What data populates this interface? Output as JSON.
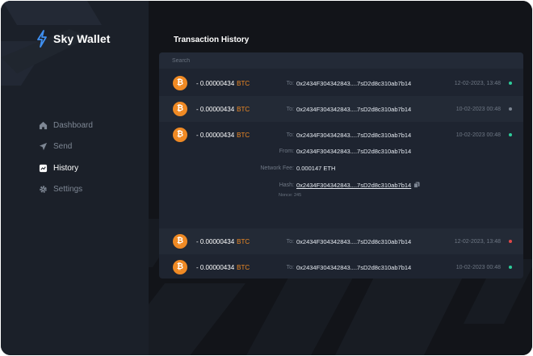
{
  "app": {
    "name": "Sky Wallet"
  },
  "colors": {
    "accent": "#f08a24",
    "success": "#2ecc9a",
    "error": "#e04848",
    "muted": "#7b8491"
  },
  "sidebar": {
    "items": [
      {
        "label": "Dashboard",
        "icon": "home-icon",
        "active": false
      },
      {
        "label": "Send",
        "icon": "send-icon",
        "active": false
      },
      {
        "label": "History",
        "icon": "history-icon",
        "active": true
      },
      {
        "label": "Settings",
        "icon": "gear-icon",
        "active": false
      }
    ]
  },
  "main": {
    "title": "Transaction History",
    "search": {
      "placeholder": "Search",
      "value": ""
    },
    "labels": {
      "to": "To:",
      "from": "From:",
      "fee": "Network Fee:",
      "hash": "Hash:",
      "nonce": "Nonce:"
    },
    "transactions": [
      {
        "amount": "- 0.00000434",
        "currency": "BTC",
        "to": "0x2434F304342843....7sD2d8c310ab7b14",
        "date": "12-02-2023, 13:48",
        "status": "success"
      },
      {
        "amount": "- 0.00000434",
        "currency": "BTC",
        "to": "0x2434F304342843....7sD2d8c310ab7b14",
        "date": "10-02-2023 00:48",
        "status": "neutral"
      },
      {
        "amount": "- 0.00000434",
        "currency": "BTC",
        "to": "0x2434F304342843....7sD2d8c310ab7b14",
        "date": "10-02-2023 00:48",
        "status": "success",
        "expanded": true,
        "from": "0x2434F304342843....7sD2d8c310ab7b14",
        "fee": "0.000147 ETH",
        "hash": "0x2434F304342843....7sD2d8c310ab7b14",
        "nonce": "245"
      },
      {
        "amount": "- 0.00000434",
        "currency": "BTC",
        "to": "0x2434F304342843....7sD2d8c310ab7b14",
        "date": "12-02-2023, 13:48",
        "status": "error"
      },
      {
        "amount": "- 0.00000434",
        "currency": "BTC",
        "to": "0x2434F304342843....7sD2d8c310ab7b14",
        "date": "10-02-2023 00:48",
        "status": "success"
      }
    ]
  }
}
